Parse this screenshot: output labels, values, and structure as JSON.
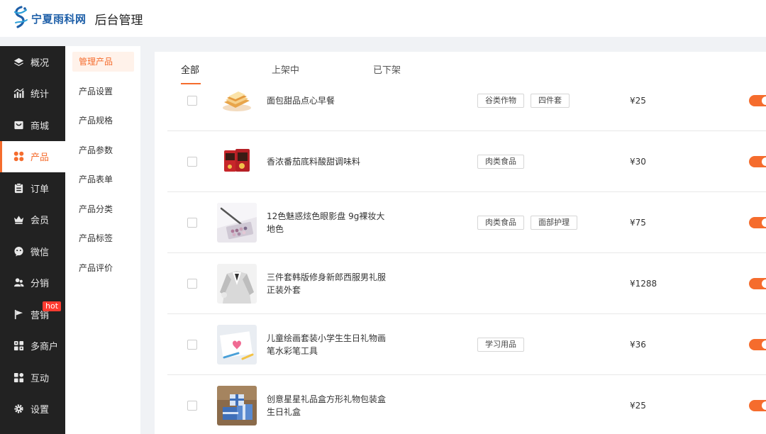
{
  "header": {
    "logo_text": "宁夏雨科网",
    "title": "后台管理"
  },
  "sidebar": {
    "items": [
      {
        "label": "概况",
        "icon": "layers-icon"
      },
      {
        "label": "统计",
        "icon": "chart-icon"
      },
      {
        "label": "商城",
        "icon": "store-icon"
      },
      {
        "label": "产品",
        "icon": "grid-icon",
        "active": true
      },
      {
        "label": "订单",
        "icon": "clipboard-icon"
      },
      {
        "label": "会员",
        "icon": "crown-icon"
      },
      {
        "label": "微信",
        "icon": "wechat-icon"
      },
      {
        "label": "分销",
        "icon": "users-icon"
      },
      {
        "label": "营销",
        "icon": "flag-icon",
        "badge": "hot"
      },
      {
        "label": "多商户",
        "icon": "shop-grid-icon"
      },
      {
        "label": "互动",
        "icon": "interact-icon"
      },
      {
        "label": "设置",
        "icon": "gear-icon"
      }
    ]
  },
  "subnav": {
    "items": [
      "管理产品",
      "产品设置",
      "产品规格",
      "产品参数",
      "产品表单",
      "产品分类",
      "产品标签",
      "产品评价"
    ],
    "active_index": 0
  },
  "tabs": [
    "全部",
    "上架中",
    "已下架"
  ],
  "products": [
    {
      "name": "面包甜品点心早餐",
      "tags": [
        "谷类作物",
        "四件套"
      ],
      "price": "¥25",
      "on": true
    },
    {
      "name": "香浓番茄底料酸甜调味料",
      "tags": [
        "肉类食品"
      ],
      "price": "¥30",
      "on": true
    },
    {
      "name": "12色魅惑炫色眼影盘 9g裸妆大地色",
      "tags": [
        "肉类食品",
        "面部护理"
      ],
      "price": "¥75",
      "on": true
    },
    {
      "name": "三件套韩版修身新郎西服男礼服正装外套",
      "tags": [],
      "price": "¥1288",
      "on": true
    },
    {
      "name": "儿童绘画套装小学生生日礼物画笔水彩笔工具",
      "tags": [
        "学习用品"
      ],
      "price": "¥36",
      "on": true
    },
    {
      "name": "创意星星礼品盒方形礼物包装盒生日礼盒",
      "tags": [],
      "price": "¥25",
      "on": true
    }
  ],
  "colors": {
    "accent": "#f56c2d",
    "sidebar_bg": "#222222",
    "hot_badge": "#ff3b30"
  }
}
